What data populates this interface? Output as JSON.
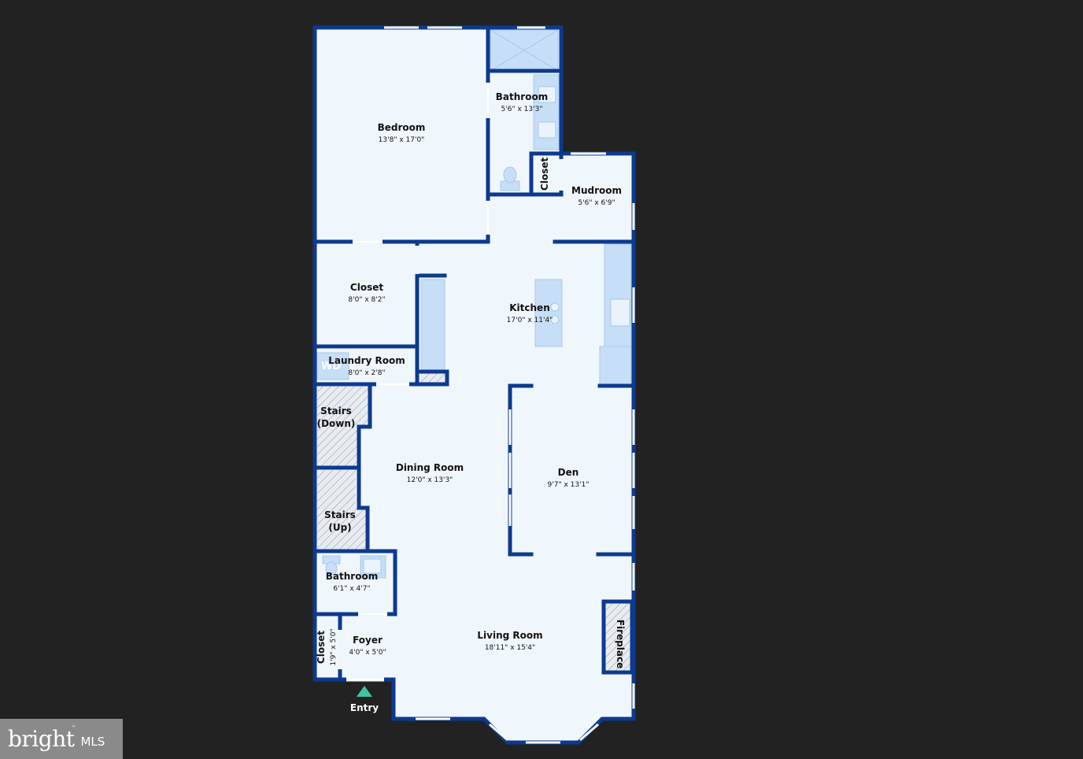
{
  "colors": {
    "background": "#222222",
    "wall": "#0d3a8f",
    "floor": "#f0f7fc",
    "fixture": "#c6def6",
    "entry_marker": "#3fc5a6"
  },
  "rooms": [
    {
      "id": "bedroom",
      "name": "Bedroom",
      "dims": "13'8\" x 17'0\""
    },
    {
      "id": "bathroom-upper",
      "name": "Bathroom",
      "dims": "5'6\" x 13'3\""
    },
    {
      "id": "closet-small",
      "name": "Closet",
      "dims": ""
    },
    {
      "id": "mudroom",
      "name": "Mudroom",
      "dims": "5'6\" x 6'9\""
    },
    {
      "id": "closet",
      "name": "Closet",
      "dims": "8'0\" x 8'2\""
    },
    {
      "id": "kitchen",
      "name": "Kitchen",
      "dims": "17'0\" x 11'4\""
    },
    {
      "id": "laundry",
      "name": "Laundry Room",
      "dims": "8'0\" x 2'8\""
    },
    {
      "id": "stairs-down",
      "name": "Stairs",
      "name2": "(Down)",
      "dims": ""
    },
    {
      "id": "dining",
      "name": "Dining Room",
      "dims": "12'0\" x 13'3\""
    },
    {
      "id": "den",
      "name": "Den",
      "dims": "9'7\" x 13'1\""
    },
    {
      "id": "stairs-up",
      "name": "Stairs",
      "name2": "(Up)",
      "dims": ""
    },
    {
      "id": "bathroom-lower",
      "name": "Bathroom",
      "dims": "6'1\" x 4'7\""
    },
    {
      "id": "closet-foyer",
      "name": "Closet",
      "dims": "1'9\" x 5'0\""
    },
    {
      "id": "foyer",
      "name": "Foyer",
      "dims": "4'0\" x 5'0\""
    },
    {
      "id": "living",
      "name": "Living Room",
      "dims": "18'11\" x 15'4\""
    },
    {
      "id": "fireplace",
      "name": "Fireplace",
      "dims": ""
    }
  ],
  "entry_label": "Entry",
  "washer_dryer_label": "WD",
  "logo": {
    "brand": "bright",
    "tm": "™",
    "mls": "MLS"
  }
}
